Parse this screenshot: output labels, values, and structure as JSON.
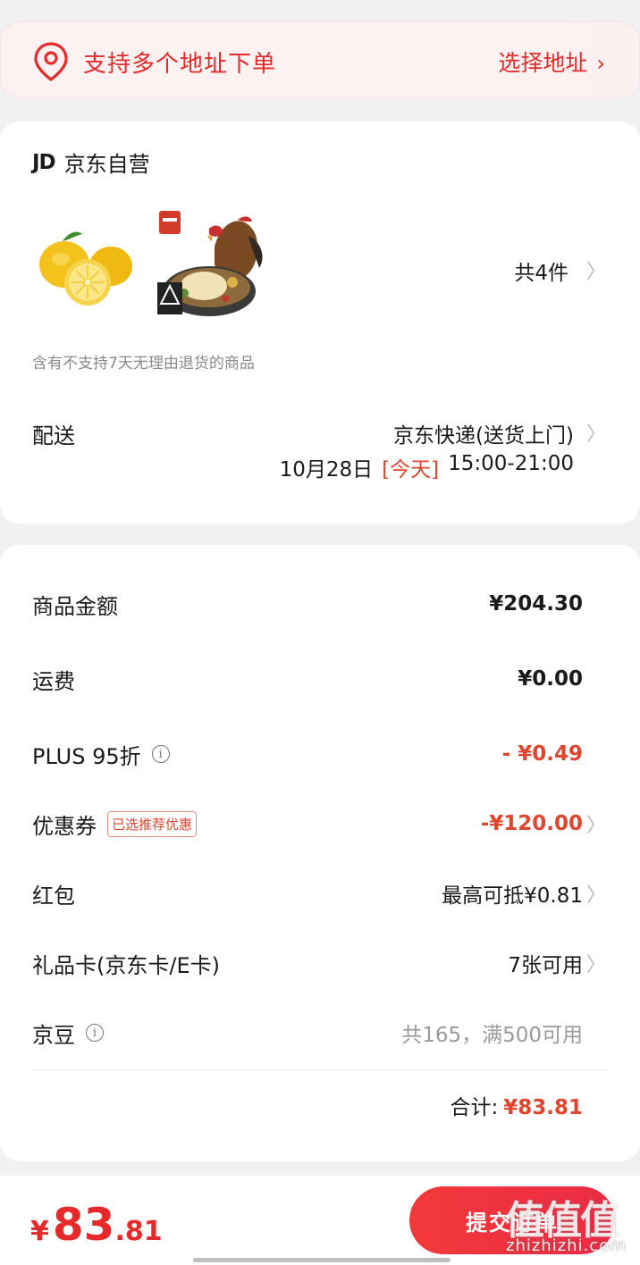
{
  "address": {
    "text": "支持多个地址下单",
    "select_label": "选择地址",
    "chevron": "›"
  },
  "store": {
    "logo": "JD",
    "name": "京东自营",
    "products": [
      {
        "icon": "lemon-product-image"
      },
      {
        "icon": "chicken-product-image"
      }
    ],
    "count_label": "共4件",
    "notice": "含有不支持7天无理由退货的商品",
    "delivery": {
      "label": "配送",
      "method": "京东快递(送货上门)",
      "date": "10月28日",
      "today": "[今天]",
      "window": "15:00-21:00"
    }
  },
  "fees": {
    "goods": {
      "label": "商品金额",
      "value": "¥204.30"
    },
    "shipping": {
      "label": "运费",
      "value": "¥0.00"
    },
    "plus": {
      "label": "PLUS 95折",
      "value": "- ¥0.49"
    },
    "coupon": {
      "label": "优惠券",
      "tag": "已选推荐优惠",
      "value": "-¥120.00"
    },
    "redpacket": {
      "label": "红包",
      "value": "最高可抵¥0.81"
    },
    "giftcard": {
      "label": "礼品卡(京东卡/E卡)",
      "value": "7张可用"
    },
    "jingdou": {
      "label": "京豆",
      "value": "共165，满500可用"
    },
    "total_label": "合计:",
    "total_value": "¥83.81"
  },
  "bottom": {
    "currency": "¥",
    "amount_int": "83",
    "amount_dec": ".81",
    "submit": "提交订单"
  },
  "watermark": {
    "brand": "值值值",
    "url": "zhizhizhi.com"
  },
  "colors": {
    "accent": "#e62a2a",
    "discount": "#e0452f",
    "muted": "#9a9a9a"
  }
}
